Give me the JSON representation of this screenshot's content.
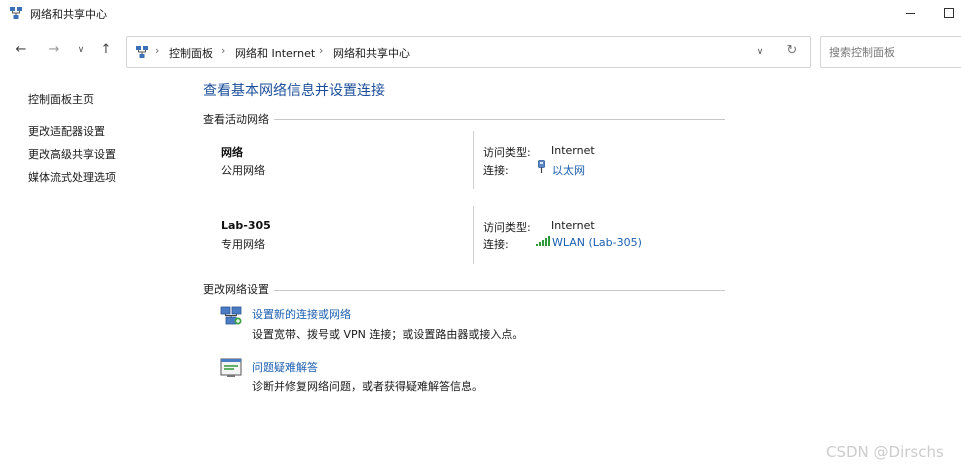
{
  "window": {
    "title": "网络和共享中心",
    "app_icon": "network-sharing-icon"
  },
  "navigation": {
    "back_icon": "back-arrow-icon",
    "forward_icon": "forward-arrow-icon",
    "recent_icon": "chevron-down-icon",
    "up_icon": "up-arrow-icon",
    "back_glyph": "←",
    "forward_glyph": "→",
    "recent_glyph": "∨",
    "up_glyph": "↑",
    "breadcrumb": [
      "控制面板",
      "网络和 Internet",
      "网络和共享中心"
    ],
    "separator": "›",
    "dropdown_glyph": "∨",
    "refresh_glyph": "↻"
  },
  "search": {
    "placeholder": "搜索控制面板"
  },
  "sidebar": {
    "items": [
      {
        "label": "控制面板主页"
      },
      {
        "label": "更改适配器设置"
      },
      {
        "label": "更改高级共享设置"
      },
      {
        "label": "媒体流式处理选项"
      }
    ]
  },
  "main": {
    "title": "查看基本网络信息并设置连接",
    "active_section": "查看活动网络",
    "networks": [
      {
        "name": "网络",
        "category": "公用网络",
        "access_label": "访问类型:",
        "access_value": "Internet",
        "conn_label": "连接:",
        "conn_value": "以太网",
        "conn_icon": "ethernet-icon"
      },
      {
        "name": "Lab-305",
        "category": "专用网络",
        "access_label": "访问类型:",
        "access_value": "Internet",
        "conn_label": "连接:",
        "conn_value": "WLAN (Lab-305)",
        "conn_icon": "wifi-signal-icon"
      }
    ],
    "change_section": "更改网络设置",
    "tasks": [
      {
        "link": "设置新的连接或网络",
        "desc": "设置宽带、拨号或 VPN 连接；或设置路由器或接入点。",
        "icon": "new-connection-icon"
      },
      {
        "link": "问题疑难解答",
        "desc": "诊断并修复网络问题，或者获得疑难解答信息。",
        "icon": "troubleshoot-icon"
      }
    ]
  },
  "watermark": "CSDN @Dirschs",
  "colors": {
    "title_blue": "#1b4e9a",
    "link_blue": "#1b5fb0",
    "divider": "#c8c8c8"
  }
}
